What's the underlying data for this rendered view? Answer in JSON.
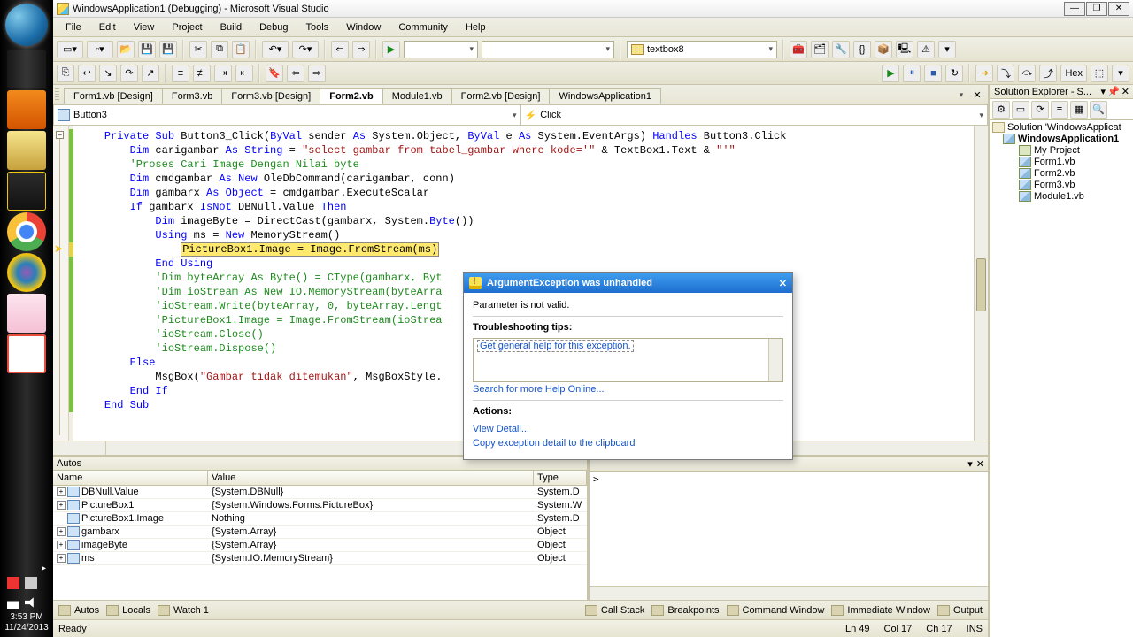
{
  "window": {
    "title": "WindowsApplication1 (Debugging) - Microsoft Visual Studio"
  },
  "menu": [
    "File",
    "Edit",
    "View",
    "Project",
    "Build",
    "Debug",
    "Tools",
    "Window",
    "Community",
    "Help"
  ],
  "toolbar_selects": {
    "target": "",
    "config": "textbox8",
    "hex": "Hex"
  },
  "tabs": [
    "Form1.vb [Design]",
    "Form3.vb",
    "Form3.vb [Design]",
    "Form2.vb",
    "Module1.vb",
    "Form2.vb [Design]",
    "WindowsApplication1"
  ],
  "active_tab": "Form2.vb",
  "nav": {
    "left": "Button3",
    "right": "Click"
  },
  "code": {
    "l1a": "Private",
    "l1b": " Sub",
    "l1c": " Button3_Click(",
    "l1d": "ByVal",
    "l1e": " sender ",
    "l1f": "As",
    "l1g": " System.Object, ",
    "l1h": "ByVal",
    "l1i": " e ",
    "l1j": "As",
    "l1k": " System.EventArgs) ",
    "l1l": "Handles",
    "l1m": " Button3.Click",
    "l2a": "Dim",
    "l2b": " carigambar ",
    "l2c": "As String",
    "l2d": " = ",
    "l2e": "\"select gambar from tabel_gambar where kode='\"",
    "l2f": " & TextBox1.Text & ",
    "l2g": "\"'\"",
    "l3": "'Proses Cari Image Dengan Nilai byte",
    "l4a": "Dim",
    "l4b": " cmdgambar ",
    "l4c": "As New",
    "l4d": " OleDbCommand(carigambar, conn)",
    "l5a": "Dim",
    "l5b": " gambarx ",
    "l5c": "As Object",
    "l5d": " = cmdgambar.ExecuteScalar",
    "l6a": "If",
    "l6b": " gambarx ",
    "l6c": "IsNot",
    "l6d": " DBNull.Value ",
    "l6e": "Then",
    "l7a": "Dim",
    "l7b": " imageByte = DirectCast(gambarx, System.",
    "l7c": "Byte",
    "l7d": "())",
    "l8a": "Using",
    "l8b": " ms = ",
    "l8c": "New",
    "l8d": " MemoryStream()",
    "l9": "PictureBox1.Image = Image.FromStream(ms)",
    "l10a": "End",
    "l10b": " Using",
    "l11": "'Dim byteArray As Byte() = CType(gambarx, Byt",
    "l12": "'Dim ioStream As New IO.MemoryStream(byteArra",
    "l13": "'ioStream.Write(byteArray, 0, byteArray.Lengt",
    "l14": "'PictureBox1.Image = Image.FromStream(ioStrea",
    "l15": "'ioStream.Close()",
    "l16": "'ioStream.Dispose()",
    "l17": "Else",
    "l18a": "        MsgBox(",
    "l18b": "\"Gambar tidak ditemukan\"",
    "l18c": ", MsgBoxStyle.",
    "l19a": "End",
    "l19b": " If",
    "l20a": "End",
    "l20b": " Sub"
  },
  "exception": {
    "title": "ArgumentException was unhandled",
    "message": "Parameter is not valid.",
    "tips_heading": "Troubleshooting tips:",
    "link": "Get general help for this exception.",
    "search": "Search for more Help Online...",
    "actions_heading": "Actions:",
    "view_detail": "View Detail...",
    "copy": "Copy exception detail to the clipboard"
  },
  "autos": {
    "title": "Autos",
    "cols": [
      "Name",
      "Value",
      "Type"
    ],
    "rows": [
      {
        "n": "DBNull.Value",
        "v": "{System.DBNull}",
        "t": "System.D"
      },
      {
        "n": "PictureBox1",
        "v": "{System.Windows.Forms.PictureBox}",
        "t": "System.W"
      },
      {
        "n": "PictureBox1.Image",
        "v": "Nothing",
        "t": "System.D",
        "noexp": true
      },
      {
        "n": "gambarx",
        "v": "{System.Array}",
        "t": "Object"
      },
      {
        "n": "imageByte",
        "v": "{System.Array}",
        "t": "Object"
      },
      {
        "n": "ms",
        "v": "{System.IO.MemoryStream}",
        "t": "Object"
      }
    ]
  },
  "cmdw": {
    "prompt": ">"
  },
  "bottom_tabs_left": [
    "Autos",
    "Locals",
    "Watch 1"
  ],
  "bottom_tabs_right": [
    "Call Stack",
    "Breakpoints",
    "Command Window",
    "Immediate Window",
    "Output"
  ],
  "solution": {
    "title": "Solution Explorer - S...",
    "root": "Solution 'WindowsApplicat",
    "proj": "WindowsApplication1",
    "items": [
      "My Project",
      "Form1.vb",
      "Form2.vb",
      "Form3.vb",
      "Module1.vb"
    ]
  },
  "status": {
    "ready": "Ready",
    "ln": "Ln 49",
    "col": "Col 17",
    "ch": "Ch 17",
    "ins": "INS"
  },
  "clock": {
    "time": "3:53 PM",
    "date": "11/24/2013"
  }
}
